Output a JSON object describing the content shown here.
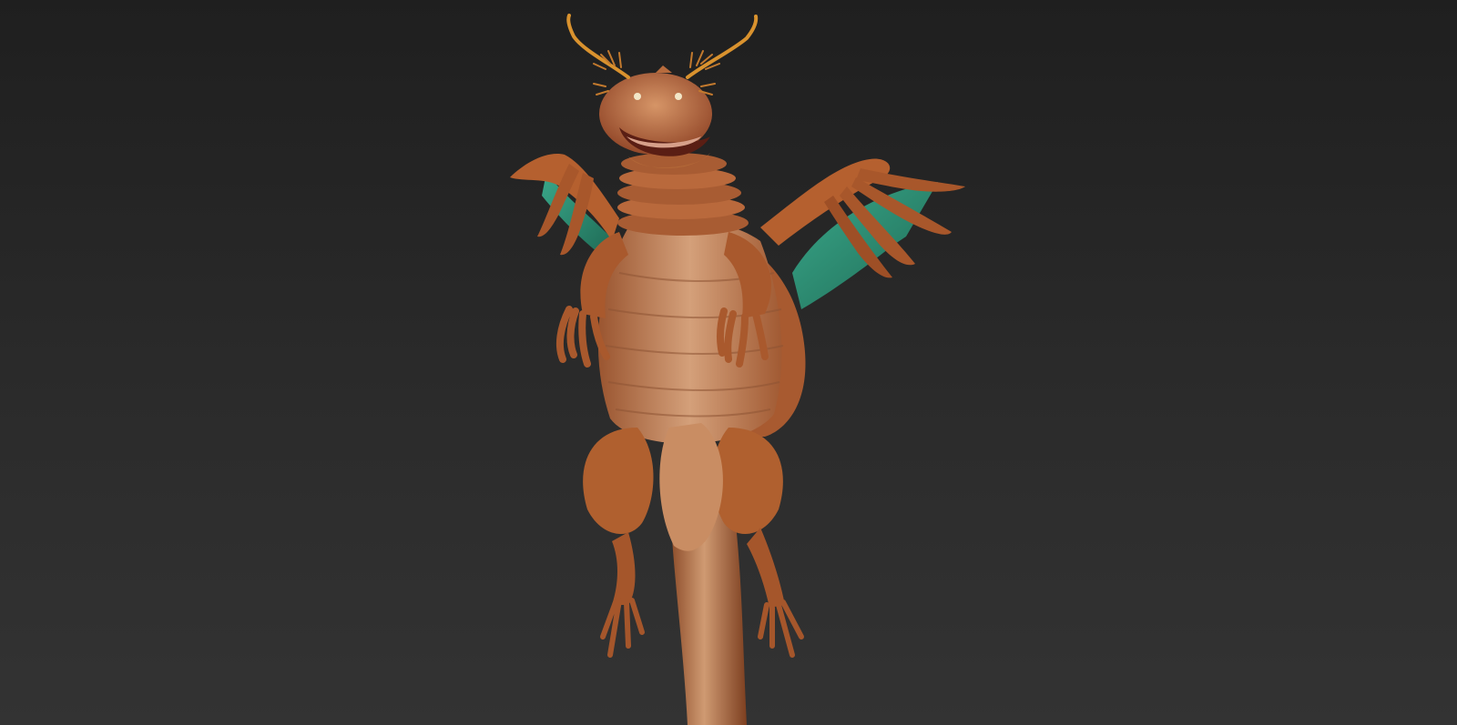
{
  "scene": {
    "subject_icon": "creature-sculpt-icon",
    "colors": {
      "background_top": "#1f1f1f",
      "background_bottom": "#333333",
      "skin_dark": "#8a3f1f",
      "skin_mid": "#b8673a",
      "skin_light": "#d49a6a",
      "belly": "#c9926a",
      "wing_membrane": "#2f9a7c",
      "horn": "#d9922e",
      "eye": "#f2e7c8",
      "mouth": "#5a1e14"
    }
  }
}
